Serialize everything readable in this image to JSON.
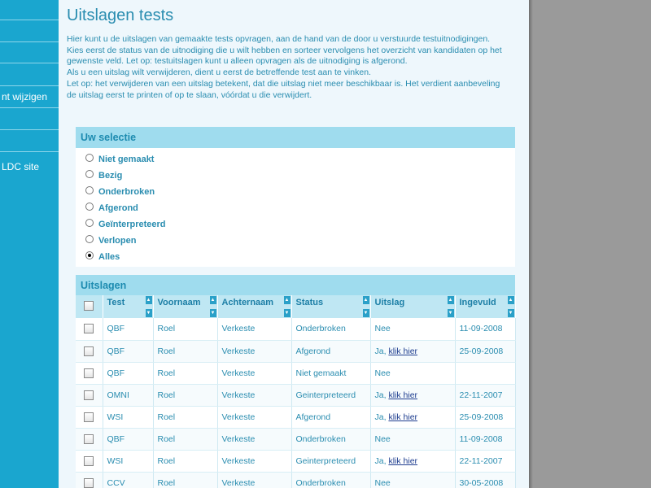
{
  "sidebar": {
    "items": [
      {
        "label": ""
      },
      {
        "label": ""
      },
      {
        "label": ""
      },
      {
        "label": "nt wijzigen"
      },
      {
        "label": ""
      },
      {
        "label": ""
      },
      {
        "label": "LDC site"
      }
    ]
  },
  "main": {
    "title": "Uitslagen tests",
    "intro": [
      "Hier kunt u de uitslagen van gemaakte tests opvragen, aan de hand van de door u verstuurde testuitnodigingen. Kies eerst de status van de uitnodiging die u wilt hebben en sorteer vervolgens het overzicht van kandidaten op het gewenste veld. Let op: testuitslagen kunt u alleen opvragen als de uitnodiging is afgerond.",
      "Als u een uitslag wilt verwijderen, dient u eerst de betreffende test aan te vinken.",
      "Let op: het verwijderen van een uitslag betekent, dat die uitslag niet meer beschikbaar is. Het verdient aanbeveling de uitslag eerst te printen of op te slaan, vóórdat u die verwijdert."
    ]
  },
  "selectie": {
    "title": "Uw selectie",
    "options": [
      {
        "label": "Niet gemaakt",
        "checked": false
      },
      {
        "label": "Bezig",
        "checked": false
      },
      {
        "label": "Onderbroken",
        "checked": false
      },
      {
        "label": "Afgerond",
        "checked": false
      },
      {
        "label": "Geïnterpreteerd",
        "checked": false
      },
      {
        "label": "Verlopen",
        "checked": false
      },
      {
        "label": "Alles",
        "checked": true
      }
    ]
  },
  "uitslagen": {
    "title": "Uitslagen",
    "columns": [
      "Test",
      "Voornaam",
      "Achternaam",
      "Status",
      "Uitslag",
      "Ingevuld"
    ],
    "rows": [
      {
        "test": "QBF",
        "voornaam": "Roel",
        "achternaam": "Verkeste",
        "status": "Onderbroken",
        "uitslag": "Nee",
        "link": "",
        "ingevuld": "11-09-2008"
      },
      {
        "test": "QBF",
        "voornaam": "Roel",
        "achternaam": "Verkeste",
        "status": "Afgerond",
        "uitslag": "Ja,",
        "link": "klik hier",
        "ingevuld": "25-09-2008"
      },
      {
        "test": "QBF",
        "voornaam": "Roel",
        "achternaam": "Verkeste",
        "status": "Niet gemaakt",
        "uitslag": "Nee",
        "link": "",
        "ingevuld": ""
      },
      {
        "test": "OMNI",
        "voornaam": "Roel",
        "achternaam": "Verkeste",
        "status": "Geinterpreteerd",
        "uitslag": "Ja,",
        "link": "klik hier",
        "ingevuld": "22-11-2007"
      },
      {
        "test": "WSI",
        "voornaam": "Roel",
        "achternaam": "Verkeste",
        "status": "Afgerond",
        "uitslag": "Ja,",
        "link": "klik hier",
        "ingevuld": "25-09-2008"
      },
      {
        "test": "QBF",
        "voornaam": "Roel",
        "achternaam": "Verkeste",
        "status": "Onderbroken",
        "uitslag": "Nee",
        "link": "",
        "ingevuld": "11-09-2008"
      },
      {
        "test": "WSI",
        "voornaam": "Roel",
        "achternaam": "Verkeste",
        "status": "Geinterpreteerd",
        "uitslag": "Ja,",
        "link": "klik hier",
        "ingevuld": "22-11-2007"
      },
      {
        "test": "CCV",
        "voornaam": "Roel",
        "achternaam": "Verkeste",
        "status": "Onderbroken",
        "uitslag": "Nee",
        "link": "",
        "ingevuld": "30-05-2008"
      }
    ]
  }
}
